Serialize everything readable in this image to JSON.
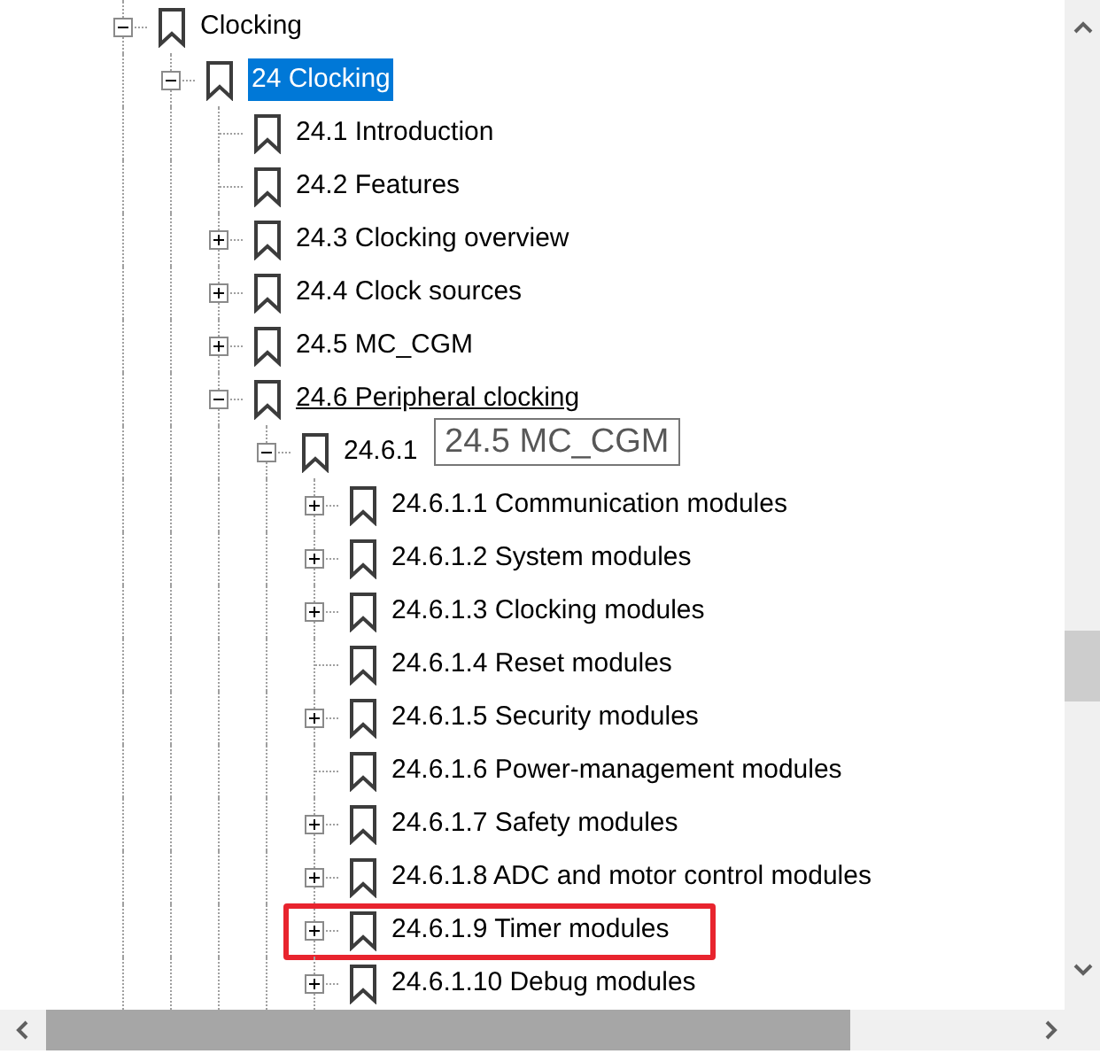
{
  "bookmarks": [
    {
      "label": "Clocking",
      "kind": "branch",
      "expanded": true,
      "selected": false,
      "hovered": false,
      "highlighted": false,
      "children": [
        {
          "label": "24 Clocking",
          "kind": "branch",
          "expanded": true,
          "selected": true,
          "hovered": false,
          "highlighted": false,
          "children": [
            {
              "label": "24.1 Introduction",
              "kind": "leaf",
              "selected": false,
              "hovered": false,
              "highlighted": false
            },
            {
              "label": "24.2 Features",
              "kind": "leaf",
              "selected": false,
              "hovered": false,
              "highlighted": false
            },
            {
              "label": "24.3 Clocking overview",
              "kind": "branch",
              "expanded": false,
              "selected": false,
              "hovered": false,
              "highlighted": false
            },
            {
              "label": "24.4 Clock sources",
              "kind": "branch",
              "expanded": false,
              "selected": false,
              "hovered": false,
              "highlighted": false
            },
            {
              "label": "24.5 MC_CGM",
              "kind": "branch",
              "expanded": false,
              "selected": false,
              "hovered": false,
              "highlighted": false
            },
            {
              "label": "24.6 Peripheral clocking",
              "kind": "branch",
              "expanded": true,
              "selected": false,
              "hovered": true,
              "highlighted": false,
              "children": [
                {
                  "label": "24.6.1",
                  "kind": "branch",
                  "expanded": true,
                  "selected": false,
                  "hovered": false,
                  "highlighted": false,
                  "children": [
                    {
                      "label": "24.6.1.1 Communication modules",
                      "kind": "branch",
                      "expanded": false,
                      "selected": false,
                      "hovered": false,
                      "highlighted": false
                    },
                    {
                      "label": "24.6.1.2 System modules",
                      "kind": "branch",
                      "expanded": false,
                      "selected": false,
                      "hovered": false,
                      "highlighted": false
                    },
                    {
                      "label": "24.6.1.3 Clocking modules",
                      "kind": "branch",
                      "expanded": false,
                      "selected": false,
                      "hovered": false,
                      "highlighted": false
                    },
                    {
                      "label": "24.6.1.4 Reset modules",
                      "kind": "leaf",
                      "selected": false,
                      "hovered": false,
                      "highlighted": false
                    },
                    {
                      "label": "24.6.1.5 Security modules",
                      "kind": "branch",
                      "expanded": false,
                      "selected": false,
                      "hovered": false,
                      "highlighted": false
                    },
                    {
                      "label": "24.6.1.6 Power-management modules",
                      "kind": "leaf",
                      "selected": false,
                      "hovered": false,
                      "highlighted": false
                    },
                    {
                      "label": "24.6.1.7 Safety modules",
                      "kind": "branch",
                      "expanded": false,
                      "selected": false,
                      "hovered": false,
                      "highlighted": false
                    },
                    {
                      "label": "24.6.1.8 ADC and motor control modules",
                      "kind": "branch",
                      "expanded": false,
                      "selected": false,
                      "hovered": false,
                      "highlighted": false
                    },
                    {
                      "label": "24.6.1.9 Timer modules",
                      "kind": "branch",
                      "expanded": false,
                      "selected": false,
                      "hovered": false,
                      "highlighted": true
                    },
                    {
                      "label": "24.6.1.10 Debug modules",
                      "kind": "branch",
                      "expanded": false,
                      "selected": false,
                      "hovered": false,
                      "highlighted": false
                    }
                  ]
                }
              ]
            }
          ]
        }
      ]
    }
  ],
  "tooltip": {
    "text": "24.5 MC_CGM"
  }
}
